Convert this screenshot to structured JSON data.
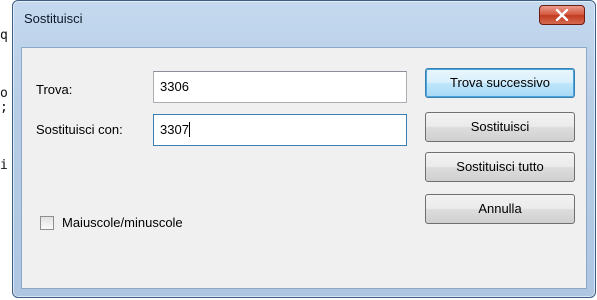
{
  "background_editor": {
    "lines": [
      "q",
      "o",
      ";",
      "i"
    ]
  },
  "dialog": {
    "title": "Sostituisci",
    "close_icon": "close-x-icon",
    "find_label": "Trova:",
    "find_value": "3306",
    "replace_label": "Sostituisci con:",
    "replace_value": "3307",
    "match_case_label": "Maiuscole/minuscole",
    "match_case_checked": false,
    "buttons": {
      "find_next": "Trova successivo",
      "replace": "Sostituisci",
      "replace_all": "Sostituisci tutto",
      "cancel": "Annulla"
    }
  },
  "colors": {
    "frame": "#b7cde6",
    "close_button": "#c8452b",
    "default_button_border": "#3c7fb1"
  }
}
